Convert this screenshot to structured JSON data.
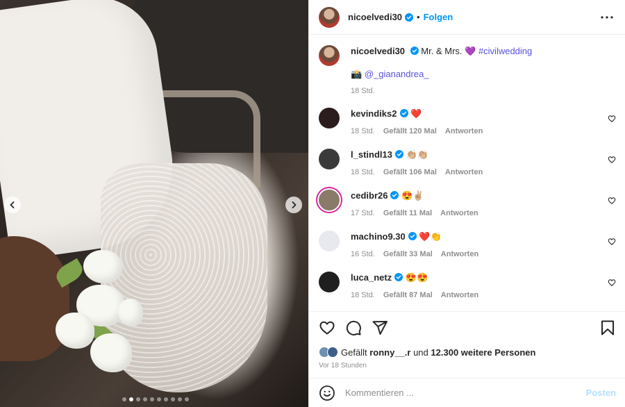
{
  "post": {
    "username": "nicoelvedi30",
    "separator": "•",
    "follow_label": "Folgen",
    "caption": {
      "text": "Mr. & Mrs. 💜",
      "hashtag": "#civilwedding",
      "credit_emoji": "📸",
      "credit_handle": "@_gianandrea_",
      "time": "18 Std."
    }
  },
  "comments": [
    {
      "user": "kevindiks2",
      "text": "❤️",
      "time": "18 Std.",
      "likes": "Gefällt 120 Mal",
      "reply": "Antworten",
      "avatar_color": "#2b1d1d"
    },
    {
      "user": "l_stindl13",
      "text": "👏🏼👏🏼",
      "time": "18 Std.",
      "likes": "Gefällt 106 Mal",
      "reply": "Antworten",
      "avatar_color": "#3a3a3a"
    },
    {
      "user": "cedibr26",
      "text": "😍✌🏼",
      "time": "17 Std.",
      "likes": "Gefällt 11 Mal",
      "reply": "Antworten",
      "avatar_color": "#8a7a6a"
    },
    {
      "user": "machino9.30",
      "text": "❤️👏",
      "time": "16 Std.",
      "likes": "Gefällt 33 Mal",
      "reply": "Antworten",
      "avatar_color": "#e8e8ef"
    },
    {
      "user": "luca_netz",
      "text": "😍😍",
      "time": "18 Std.",
      "likes": "Gefällt 87 Mal",
      "reply": "Antworten",
      "avatar_color": "#1f1f1f"
    }
  ],
  "likes": {
    "prefix": "Gefällt",
    "user": "ronny__.r",
    "and": "und",
    "others": "12.300 weitere Personen"
  },
  "posted_ago": "Vor 18 Stunden",
  "comment_input": {
    "placeholder": "Kommentieren ...",
    "post_label": "Posten"
  },
  "carousel": {
    "dots": 10,
    "active_index": 1
  },
  "colors": {
    "accent": "#0095f6",
    "verified": "#0095f6",
    "hashtag": "#5851db",
    "post_disabled": "#b2dffc"
  },
  "icons": {
    "verified": "verified-badge-icon",
    "more": "more-icon",
    "heart": "heart-icon",
    "comment": "comment-icon",
    "share": "share-icon",
    "save": "bookmark-icon",
    "emoji": "emoji-icon",
    "prev": "chevron-left-icon",
    "next": "chevron-right-icon"
  }
}
